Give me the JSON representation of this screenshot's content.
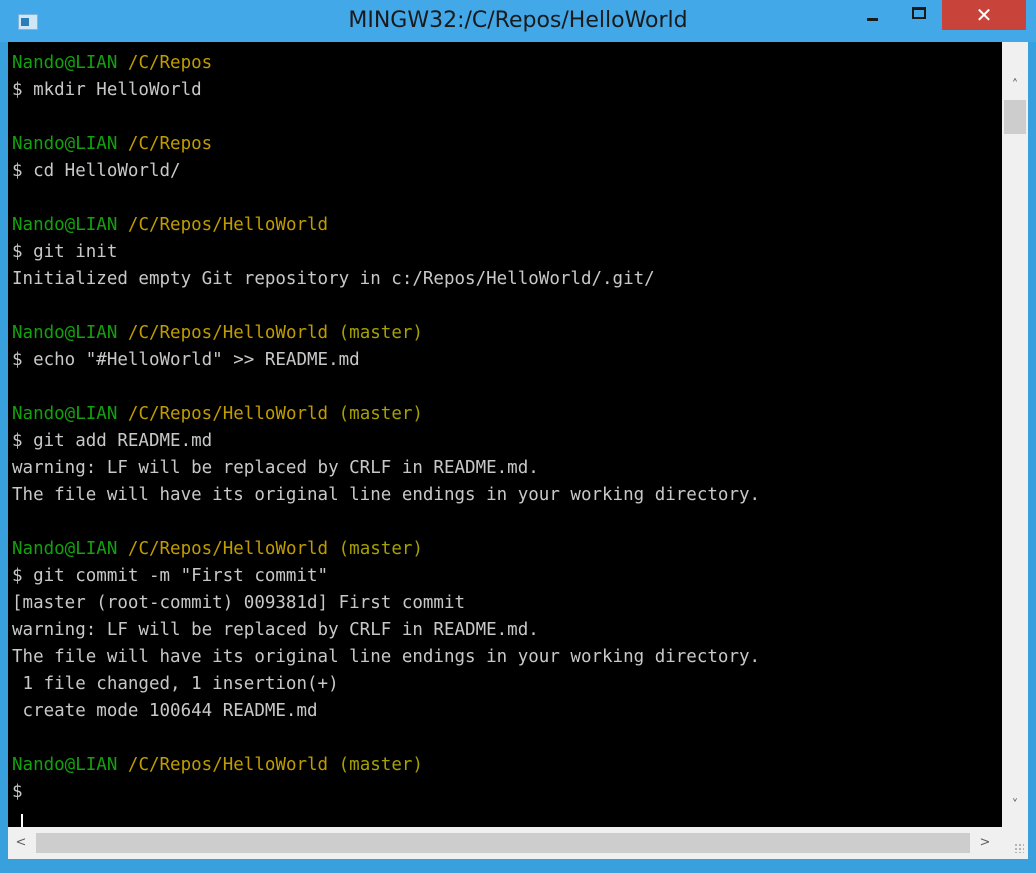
{
  "window": {
    "title": "MINGW32:/C/Repos/HelloWorld",
    "close_glyph": "✕",
    "icons": [
      "console-app-icon",
      "minimize-icon",
      "maximize-icon",
      "close-icon"
    ]
  },
  "terminal": {
    "colors": {
      "background": "#000000",
      "text": "#c8c8c8",
      "user": "#13a10e",
      "path": "#c19c00"
    },
    "lines": [
      {
        "type": "prompt",
        "user": "Nando@LIAN",
        "path": "/C/Repos",
        "branch": ""
      },
      {
        "type": "text",
        "text": "$ mkdir HelloWorld"
      },
      {
        "type": "blank",
        "text": ""
      },
      {
        "type": "prompt",
        "user": "Nando@LIAN",
        "path": "/C/Repos",
        "branch": ""
      },
      {
        "type": "text",
        "text": "$ cd HelloWorld/"
      },
      {
        "type": "blank",
        "text": ""
      },
      {
        "type": "prompt",
        "user": "Nando@LIAN",
        "path": "/C/Repos/HelloWorld",
        "branch": ""
      },
      {
        "type": "text",
        "text": "$ git init"
      },
      {
        "type": "text",
        "text": "Initialized empty Git repository in c:/Repos/HelloWorld/.git/"
      },
      {
        "type": "blank",
        "text": ""
      },
      {
        "type": "prompt",
        "user": "Nando@LIAN",
        "path": "/C/Repos/HelloWorld",
        "branch": "(master)"
      },
      {
        "type": "text",
        "text": "$ echo \"#HelloWorld\" >> README.md"
      },
      {
        "type": "blank",
        "text": ""
      },
      {
        "type": "prompt",
        "user": "Nando@LIAN",
        "path": "/C/Repos/HelloWorld",
        "branch": "(master)"
      },
      {
        "type": "text",
        "text": "$ git add README.md"
      },
      {
        "type": "text",
        "text": "warning: LF will be replaced by CRLF in README.md."
      },
      {
        "type": "text",
        "text": "The file will have its original line endings in your working directory."
      },
      {
        "type": "blank",
        "text": ""
      },
      {
        "type": "prompt",
        "user": "Nando@LIAN",
        "path": "/C/Repos/HelloWorld",
        "branch": "(master)"
      },
      {
        "type": "text",
        "text": "$ git commit -m \"First commit\""
      },
      {
        "type": "text",
        "text": "[master (root-commit) 009381d] First commit"
      },
      {
        "type": "text",
        "text": "warning: LF will be replaced by CRLF in README.md."
      },
      {
        "type": "text",
        "text": "The file will have its original line endings in your working directory."
      },
      {
        "type": "text",
        "text": " 1 file changed, 1 insertion(+)"
      },
      {
        "type": "text",
        "text": " create mode 100644 README.md"
      },
      {
        "type": "blank",
        "text": ""
      },
      {
        "type": "prompt",
        "user": "Nando@LIAN",
        "path": "/C/Repos/HelloWorld",
        "branch": "(master)"
      },
      {
        "type": "text",
        "text": "$"
      }
    ]
  },
  "scrollbars": {
    "up_arrow": "˄",
    "down_arrow": "˅",
    "left_arrow": "<",
    "right_arrow": ">"
  }
}
